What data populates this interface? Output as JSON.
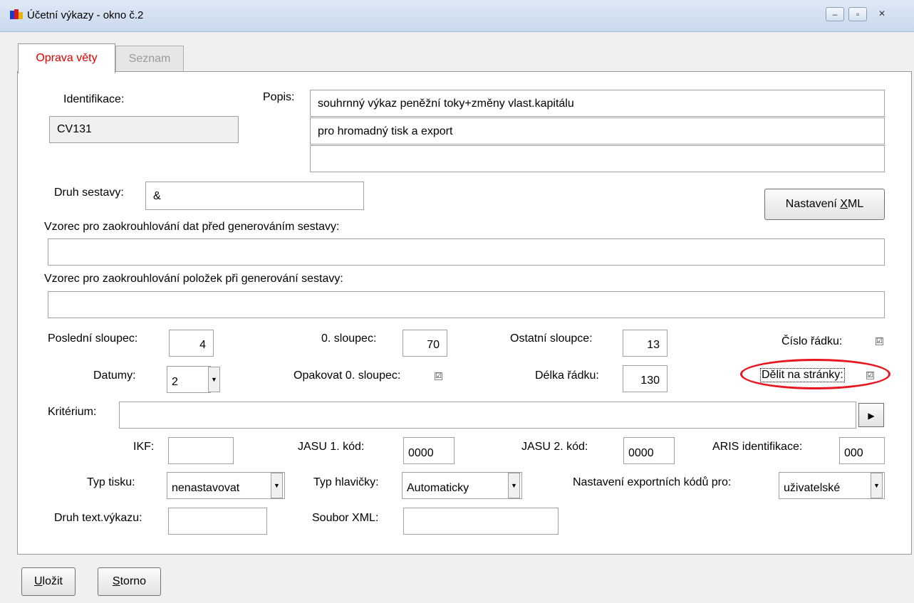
{
  "window": {
    "title": "Účetní výkazy - okno č.2",
    "min": "–",
    "max": "▫",
    "close": "✕"
  },
  "tabs": {
    "edit": "Oprava věty",
    "list": "Seznam"
  },
  "identifikace": {
    "label": "Identifikace:",
    "value": "CV131"
  },
  "popis": {
    "label": "Popis:",
    "line1": "souhrnný výkaz peněžní toky+změny vlast.kapitálu",
    "line2": "pro hromadný tisk a export",
    "line3": ""
  },
  "druh_sestavy": {
    "label": "Druh sestavy:",
    "value": "&"
  },
  "xml_button": {
    "pre": "Nastavení ",
    "key": "X",
    "post": "ML"
  },
  "vzorec1": {
    "label": "Vzorec pro zaokrouhlování dat před generováním sestavy:",
    "value": ""
  },
  "vzorec2": {
    "label": "Vzorec pro zaokrouhlování položek při generování sestavy:",
    "value": ""
  },
  "posledni_sloupec": {
    "label": "Poslední sloupec:",
    "value": "4"
  },
  "nulty_sloupec": {
    "label": "0. sloupec:",
    "value": "70"
  },
  "ostatni_sloupce": {
    "label": "Ostatní sloupce:",
    "value": "13"
  },
  "cislo_radku": {
    "label": "Číslo řádku:",
    "checked": "☑"
  },
  "datumy": {
    "label": "Datumy:",
    "value": "2"
  },
  "opakovat": {
    "label": "Opakovat 0. sloupec:",
    "checked": "☑"
  },
  "delka_radku": {
    "label": "Délka řádku:",
    "value": "130"
  },
  "delit": {
    "label": "Dělit na stránky:",
    "checked": "☑",
    "highlight_color": "#e8141e"
  },
  "kriterium": {
    "label": "Kritérium:",
    "value": ""
  },
  "ikf": {
    "label": "IKF:",
    "value": ""
  },
  "jasu1": {
    "label": "JASU 1. kód:",
    "value": "0000"
  },
  "jasu2": {
    "label": "JASU 2. kód:",
    "value": "0000"
  },
  "aris": {
    "label": "ARIS identifikace:",
    "value": "000"
  },
  "typ_tisku": {
    "label": "Typ tisku:",
    "value": "nenastavovat"
  },
  "typ_hlavicky": {
    "label": "Typ hlavičky:",
    "value": "Automaticky"
  },
  "export_kody": {
    "label": "Nastavení exportních kódů pro:",
    "value": "uživatelské"
  },
  "druh_text": {
    "label": "Druh text.výkazu:",
    "value": ""
  },
  "soubor_xml": {
    "label": "Soubor XML:",
    "value": ""
  },
  "buttons": {
    "save_key": "U",
    "save_rest": "ložit",
    "cancel_key": "S",
    "cancel_rest": "torno"
  }
}
